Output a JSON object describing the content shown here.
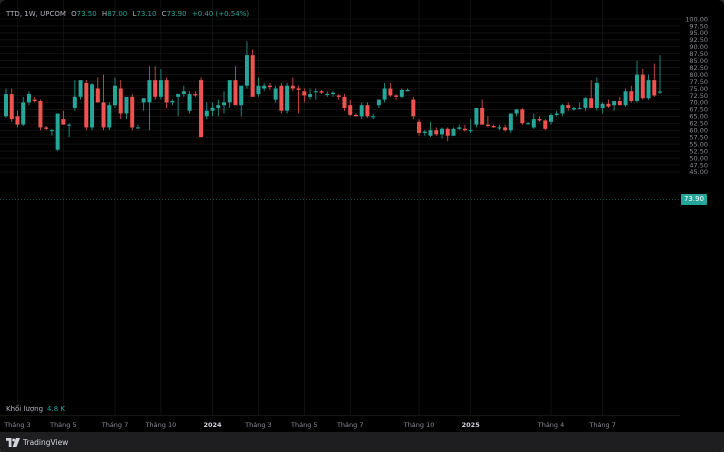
{
  "legend": {
    "symbol": "TTD, 1W, UPCOM",
    "open_key": "O",
    "open": "73.50",
    "high_key": "H",
    "high": "87.00",
    "low_key": "L",
    "low": "73.10",
    "close_key": "C",
    "close": "73.90",
    "change": "+0.40 (+0.54%)"
  },
  "volume": {
    "label": "Khối lượng",
    "value": "4.8 K"
  },
  "price_tag": "73.90",
  "footer": {
    "brand": "TradingView"
  },
  "colors": {
    "up": "#26a69a",
    "down": "#ef5350",
    "grid": "#1c1c1c",
    "axis_text": "#8a8d96",
    "price_line": "#26a69a"
  },
  "chart_data": {
    "type": "candlestick",
    "interval": "1W",
    "y_ticks": [
      "100.00",
      "97.50",
      "95.00",
      "92.50",
      "90.00",
      "87.50",
      "85.00",
      "82.50",
      "80.00",
      "77.50",
      "75.00",
      "72.50",
      "70.00",
      "67.50",
      "65.00",
      "62.50",
      "60.00",
      "57.50",
      "55.00",
      "52.50",
      "50.00",
      "47.50",
      "45.00"
    ],
    "ylim": [
      45,
      100
    ],
    "x_ticks": [
      {
        "label": "Tháng 3",
        "i": 2
      },
      {
        "label": "Tháng 5",
        "i": 10
      },
      {
        "label": "Tháng 7",
        "i": 19
      },
      {
        "label": "Tháng 10",
        "i": 27
      },
      {
        "label": "2024",
        "i": 36
      },
      {
        "label": "Tháng 3",
        "i": 44
      },
      {
        "label": "Tháng 5",
        "i": 52
      },
      {
        "label": "Tháng 7",
        "i": 60
      },
      {
        "label": "Tháng 10",
        "i": 72
      },
      {
        "label": "2025",
        "i": 81
      },
      {
        "label": "Tháng 4",
        "i": 95
      },
      {
        "label": "Tháng 7",
        "i": 104
      }
    ],
    "candles": [
      [
        65.0,
        75.0,
        64.5,
        73.0
      ],
      [
        73.0,
        75.0,
        63.0,
        64.0
      ],
      [
        65.0,
        67.0,
        61.0,
        62.0
      ],
      [
        62.0,
        72.0,
        61.5,
        70.0
      ],
      [
        70.0,
        74.0,
        69.0,
        73.0
      ],
      [
        71.0,
        72.0,
        70.0,
        70.5
      ],
      [
        70.5,
        71.0,
        60.0,
        61.0
      ],
      [
        61.0,
        61.5,
        60.0,
        60.5
      ],
      [
        60.0,
        60.5,
        58.0,
        60.0
      ],
      [
        53.0,
        66.0,
        52.5,
        66.0
      ],
      [
        64.0,
        67.0,
        63.0,
        62.0
      ],
      [
        62.0,
        62.5,
        57.5,
        62.0
      ],
      [
        68.0,
        78.0,
        67.0,
        72.0
      ],
      [
        72.0,
        78.0,
        71.0,
        78.0
      ],
      [
        77.0,
        78.0,
        60.0,
        61.0
      ],
      [
        61.0,
        77.0,
        60.0,
        76.5
      ],
      [
        75.0,
        79.0,
        73.0,
        70.0
      ],
      [
        70.0,
        80.0,
        60.0,
        61.0
      ],
      [
        61.0,
        70.0,
        60.0,
        69.0
      ],
      [
        69.0,
        79.0,
        68.0,
        76.0
      ],
      [
        75.0,
        78.0,
        64.0,
        66.0
      ],
      [
        66.0,
        69.0,
        64.0,
        72.0
      ],
      [
        72.0,
        73.0,
        60.0,
        61.0
      ],
      [
        61.0,
        62.0,
        60.5,
        61.0
      ],
      [
        70.0,
        71.0,
        67.0,
        71.5
      ],
      [
        70.0,
        83.0,
        60.0,
        78.0
      ],
      [
        78.0,
        83.0,
        71.0,
        72.0
      ],
      [
        72.0,
        82.0,
        71.0,
        78.0
      ],
      [
        78.0,
        79.0,
        68.0,
        70.0
      ],
      [
        70.0,
        71.0,
        69.0,
        70.5
      ],
      [
        72.0,
        73.0,
        65.0,
        73.0
      ],
      [
        73.0,
        76.0,
        72.0,
        74.0
      ],
      [
        67.0,
        74.0,
        66.0,
        73.0
      ],
      [
        73.0,
        74.0,
        72.0,
        72.5
      ],
      [
        78.0,
        79.0,
        57.5,
        57.5
      ],
      [
        65.0,
        70.0,
        64.0,
        67.0
      ],
      [
        67.0,
        70.0,
        65.0,
        68.0
      ],
      [
        68.0,
        71.0,
        65.0,
        69.0
      ],
      [
        69.0,
        74.0,
        66.0,
        70.0
      ],
      [
        70.0,
        74.0,
        68.0,
        78.0
      ],
      [
        78.0,
        83.0,
        70.0,
        69.0
      ],
      [
        69.0,
        70.0,
        65.0,
        76.0
      ],
      [
        76.0,
        92.0,
        75.0,
        87.0
      ],
      [
        87.0,
        89.0,
        75.0,
        72.0
      ],
      [
        73.0,
        79.0,
        72.0,
        76.0
      ],
      [
        75.0,
        77.0,
        74.0,
        76.0
      ],
      [
        76.0,
        77.0,
        74.5,
        75.5
      ],
      [
        71.0,
        76.0,
        70.0,
        75.0
      ],
      [
        76.0,
        77.0,
        66.0,
        67.0
      ],
      [
        67.0,
        77.0,
        66.0,
        76.0
      ],
      [
        76.0,
        79.0,
        74.0,
        75.0
      ],
      [
        75.0,
        76.0,
        66.0,
        74.5
      ],
      [
        74.0,
        75.0,
        70.0,
        72.5
      ],
      [
        72.0,
        75.0,
        71.0,
        73.0
      ],
      [
        74.0,
        75.0,
        71.0,
        74.0
      ],
      [
        74.0,
        74.5,
        73.0,
        73.5
      ],
      [
        73.0,
        74.0,
        72.0,
        73.0
      ],
      [
        73.0,
        74.0,
        72.0,
        73.5
      ],
      [
        72.5,
        73.0,
        71.0,
        72.0
      ],
      [
        72.0,
        73.0,
        67.0,
        68.0
      ],
      [
        69.0,
        71.0,
        65.0,
        65.5
      ],
      [
        65.5,
        66.0,
        65.0,
        65.0
      ],
      [
        65.0,
        70.0,
        64.0,
        69.0
      ],
      [
        69.0,
        70.0,
        64.5,
        65.0
      ],
      [
        65.0,
        66.0,
        64.0,
        65.0
      ],
      [
        69.0,
        71.0,
        68.0,
        71.0
      ],
      [
        71.0,
        77.0,
        70.0,
        75.0
      ],
      [
        75.0,
        77.0,
        72.0,
        72.5
      ],
      [
        72.5,
        73.0,
        71.0,
        72.0
      ],
      [
        72.0,
        75.0,
        71.5,
        74.5
      ],
      [
        74.0,
        75.0,
        74.0,
        74.5
      ],
      [
        71.0,
        72.0,
        64.0,
        65.0
      ],
      [
        63.0,
        64.0,
        58.0,
        59.0
      ],
      [
        59.0,
        60.0,
        58.0,
        59.5
      ],
      [
        58.0,
        63.0,
        57.5,
        60.0
      ],
      [
        60.0,
        61.0,
        58.0,
        58.5
      ],
      [
        58.5,
        61.0,
        57.0,
        60.5
      ],
      [
        60.5,
        61.0,
        56.0,
        58.0
      ],
      [
        58.0,
        61.0,
        58.0,
        60.5
      ],
      [
        60.5,
        62.0,
        60.0,
        61.0
      ],
      [
        60.5,
        62.0,
        59.5,
        60.0
      ],
      [
        60.0,
        64.0,
        59.0,
        60.0
      ],
      [
        62.0,
        65.0,
        61.0,
        68.0
      ],
      [
        68.0,
        71.0,
        63.5,
        62.0
      ],
      [
        62.0,
        65.0,
        61.0,
        61.5
      ],
      [
        61.5,
        62.0,
        61.0,
        61.0
      ],
      [
        61.0,
        62.0,
        60.0,
        61.0
      ],
      [
        61.0,
        62.0,
        59.5,
        60.0
      ],
      [
        60.0,
        66.0,
        59.0,
        66.0
      ],
      [
        66.0,
        67.5,
        65.0,
        67.5
      ],
      [
        67.5,
        68.0,
        62.0,
        62.5
      ],
      [
        62.5,
        63.0,
        62.0,
        62.5
      ],
      [
        61.0,
        66.0,
        60.5,
        64.0
      ],
      [
        64.0,
        65.0,
        63.0,
        63.5
      ],
      [
        63.5,
        64.0,
        60.0,
        60.5
      ],
      [
        63.0,
        66.0,
        62.0,
        65.5
      ],
      [
        65.5,
        67.0,
        65.0,
        66.0
      ],
      [
        66.0,
        69.5,
        65.0,
        69.0
      ],
      [
        69.0,
        70.0,
        67.0,
        68.0
      ],
      [
        67.5,
        68.5,
        67.0,
        68.0
      ],
      [
        68.0,
        70.0,
        67.5,
        68.0
      ],
      [
        68.0,
        72.0,
        67.0,
        71.5
      ],
      [
        71.5,
        78.0,
        71.0,
        68.0
      ],
      [
        68.0,
        79.0,
        67.0,
        77.0
      ],
      [
        68.0,
        70.0,
        66.0,
        69.5
      ],
      [
        69.5,
        71.0,
        68.0,
        68.5
      ],
      [
        69.0,
        70.0,
        67.0,
        70.5
      ],
      [
        70.5,
        72.0,
        69.5,
        69.0
      ],
      [
        69.0,
        75.0,
        68.5,
        74.0
      ],
      [
        74.0,
        76.0,
        70.0,
        70.5
      ],
      [
        70.5,
        85.0,
        70.0,
        80.0
      ],
      [
        80.0,
        82.0,
        71.0,
        71.5
      ],
      [
        71.5,
        80.0,
        71.0,
        78.0
      ],
      [
        78.0,
        84.0,
        72.0,
        72.5
      ],
      [
        73.5,
        87.0,
        73.1,
        73.9
      ]
    ]
  }
}
